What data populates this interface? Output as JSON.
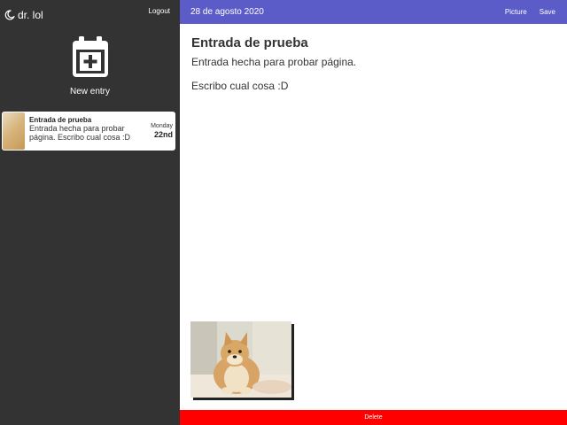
{
  "sidebar": {
    "brand_name": "dr. lol",
    "brand_icon": "moon-icon",
    "logout_label": "Logout",
    "new_entry_icon": "calendar-plus-icon",
    "new_entry_label": "New entry",
    "entries": [
      {
        "title": "Entrada de prueba",
        "excerpt": "Entrada hecha para probar página. Escribo cual cosa :D",
        "weekday": "Monday",
        "day": "22nd"
      }
    ]
  },
  "topbar": {
    "date": "28 de agosto 2020",
    "picture_label": "Picture",
    "save_label": "Save"
  },
  "entry": {
    "title": "Entrada de prueba",
    "paragraphs": [
      "Entrada hecha para probar página.",
      "Escribo cual cosa :D"
    ]
  },
  "footer": {
    "delete_label": "Delete"
  },
  "colors": {
    "sidebar_bg": "#333333",
    "topbar_bg": "#5c5cc9",
    "delete_bg": "#ff0000"
  }
}
